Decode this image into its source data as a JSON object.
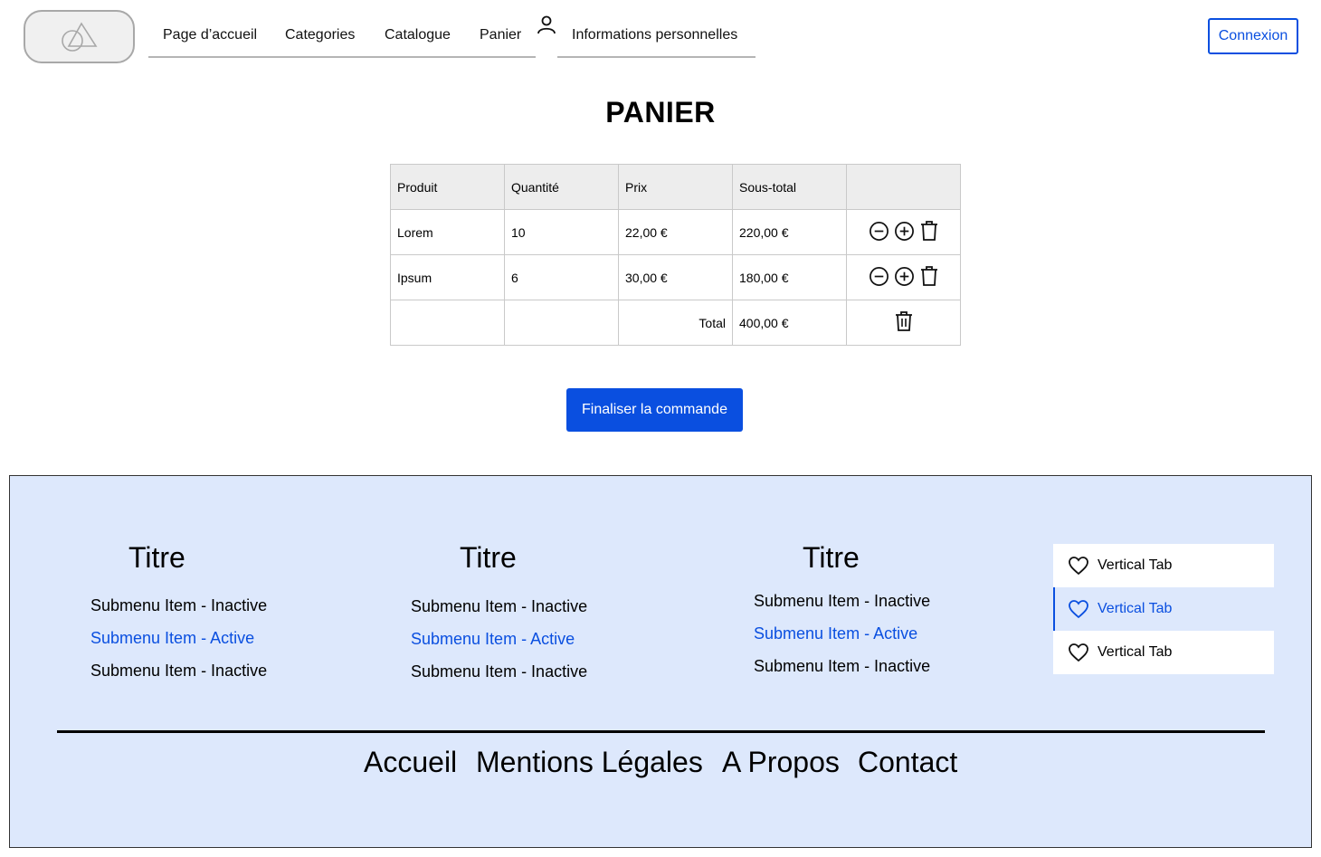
{
  "header": {
    "nav": [
      "Page d’accueil",
      "Categories",
      "Catalogue",
      "Panier",
      "Informations personnelles"
    ],
    "login_label": "Connexion"
  },
  "page_title": "PANIER",
  "cart": {
    "headers": [
      "Produit",
      "Quantité",
      "Prix",
      "Sous-total",
      ""
    ],
    "rows": [
      {
        "product": "Lorem",
        "quantity": "10",
        "price": "22,00 €",
        "subtotal": "220,00 €"
      },
      {
        "product": "Ipsum",
        "quantity": "6",
        "price": "30,00 €",
        "subtotal": "180,00 €"
      }
    ],
    "total_label": "Total",
    "total_value": "400,00 €"
  },
  "checkout_label": "Finaliser la commande",
  "footer": {
    "columns": [
      {
        "title": "Titre",
        "items": [
          {
            "label": "Submenu Item - Inactive",
            "active": false
          },
          {
            "label": "Submenu Item - Active",
            "active": true
          },
          {
            "label": "Submenu Item - Inactive",
            "active": false
          }
        ]
      },
      {
        "title": "Titre",
        "items": [
          {
            "label": "Submenu Item - Inactive",
            "active": false
          },
          {
            "label": "Submenu Item - Active",
            "active": true
          },
          {
            "label": "Submenu Item - Inactive",
            "active": false
          }
        ]
      },
      {
        "title": "Titre",
        "items": [
          {
            "label": "Submenu Item - Inactive",
            "active": false
          },
          {
            "label": "Submenu Item - Active",
            "active": true
          },
          {
            "label": "Submenu Item - Inactive",
            "active": false
          }
        ]
      }
    ],
    "vertical_tabs": [
      {
        "label": "Vertical Tab",
        "active": false,
        "icon": "heart-icon"
      },
      {
        "label": "Vertical Tab",
        "active": true,
        "icon": "heart-icon"
      },
      {
        "label": "Vertical Tab",
        "active": false,
        "icon": "heart-icon"
      }
    ],
    "links": [
      "Accueil",
      "Mentions Légales",
      "A Propos",
      "Contact"
    ]
  },
  "colors": {
    "accent": "#0a4fe0",
    "footer_bg": "#dde8fc",
    "table_header_bg": "#ededed"
  }
}
